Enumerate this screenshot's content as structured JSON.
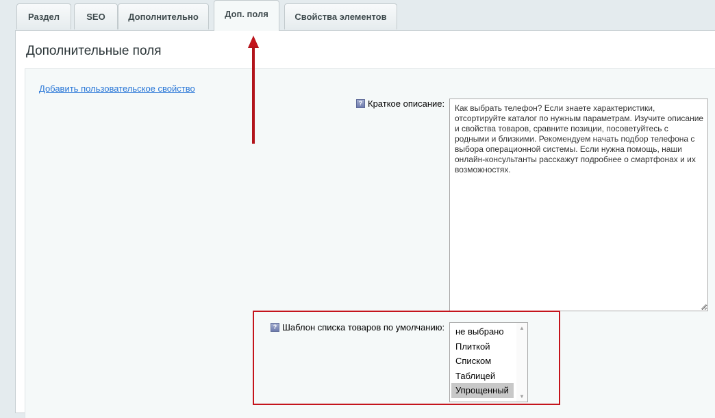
{
  "tabs": [
    {
      "label": "Раздел",
      "active": false
    },
    {
      "label": "SEO",
      "active": false
    },
    {
      "label": "Дополнительно",
      "active": false
    },
    {
      "label": "Доп. поля",
      "active": true
    },
    {
      "label": "Свойства элементов",
      "active": false
    }
  ],
  "panel": {
    "title": "Дополнительные поля",
    "add_property_link": "Добавить пользовательское свойство"
  },
  "short_description": {
    "help_icon": "question-icon",
    "label": "Краткое описание:",
    "value": "Как выбрать телефон? Если знаете характеристики, отсортируйте каталог по нужным параметрам. Изучите описание и свойства товаров, сравните позиции, посоветуйтесь с родными и близкими. Рекомендуем начать подбор телефона с выбора операционной системы. Если нужна помощь, наши онлайн-консультанты расскажут подробнее о смартфонах и их возможностях."
  },
  "list_template": {
    "help_icon": "question-icon",
    "label": "Шаблон списка товаров по умолчанию:",
    "options": [
      "не выбрано",
      "Плиткой",
      "Списком",
      "Таблицей",
      "Упрощенный"
    ],
    "selected": "Упрощенный"
  },
  "colors": {
    "link": "#2675d7",
    "annotation": "#c4141c",
    "background": "#e4ebee"
  }
}
